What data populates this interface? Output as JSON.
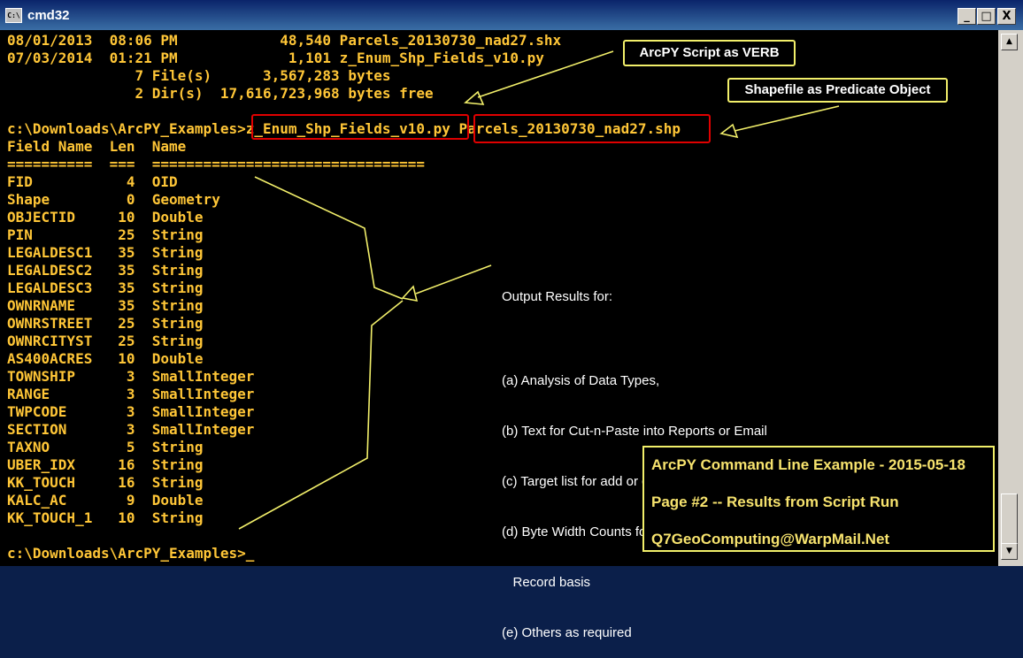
{
  "window": {
    "title": "cmd32",
    "icon": "console-icon",
    "controls": [
      "_",
      "□",
      "X"
    ]
  },
  "console": {
    "lines": [
      "08/01/2013  08:06 PM            48,540 Parcels_20130730_nad27.shx",
      "07/03/2014  01:21 PM             1,101 z_Enum_Shp_Fields_v10.py",
      "               7 File(s)      3,567,283 bytes",
      "               2 Dir(s)  17,616,723,968 bytes free",
      "",
      "c:\\Downloads\\ArcPY_Examples>z_Enum_Shp_Fields_v10.py Parcels_20130730_nad27.shp",
      "Field Name  Len  Name",
      "==========  ===  ================================",
      "FID           4  OID",
      "Shape         0  Geometry",
      "OBJECTID     10  Double",
      "PIN          25  String",
      "LEGALDESC1   35  String",
      "LEGALDESC2   35  String",
      "LEGALDESC3   35  String",
      "OWNRNAME     35  String",
      "OWNRSTREET   25  String",
      "OWNRCITYST   25  String",
      "AS400ACRES   10  Double",
      "TOWNSHIP      3  SmallInteger",
      "RANGE         3  SmallInteger",
      "TWPCODE       3  SmallInteger",
      "SECTION       3  SmallInteger",
      "TAXNO         5  String",
      "UBER_IDX     16  String",
      "KK_TOUCH     16  String",
      "KALC_AC       9  Double",
      "KK_TOUCH_1   10  String",
      "",
      "c:\\Downloads\\ArcPY_Examples>_"
    ]
  },
  "annotations": {
    "verb_callout": "ArcPY Script as VERB",
    "object_callout": "Shapefile as Predicate Object",
    "output_results": [
      "Output Results for:",
      "",
      "(a) Analysis of Data Types,",
      "(b) Text for Cut-n-Paste into Reports or Email",
      "(c) Target list for add or drop of attributes by Col Name",
      "(d) Byte Width Counts for storage estimates on per",
      "   Record basis",
      "(e) Others as required"
    ],
    "info_box": {
      "line1": "ArcPY Command Line Example - 2015-05-18",
      "line2": "Page #2 -- Results from Script Run",
      "line3": "Q7GeoComputing@WarpMail.Net"
    }
  },
  "colors": {
    "console_text": "#ffc637",
    "highlight": "#e00000",
    "callout_border": "#f2ef6a",
    "info_text": "#f7e36e"
  }
}
